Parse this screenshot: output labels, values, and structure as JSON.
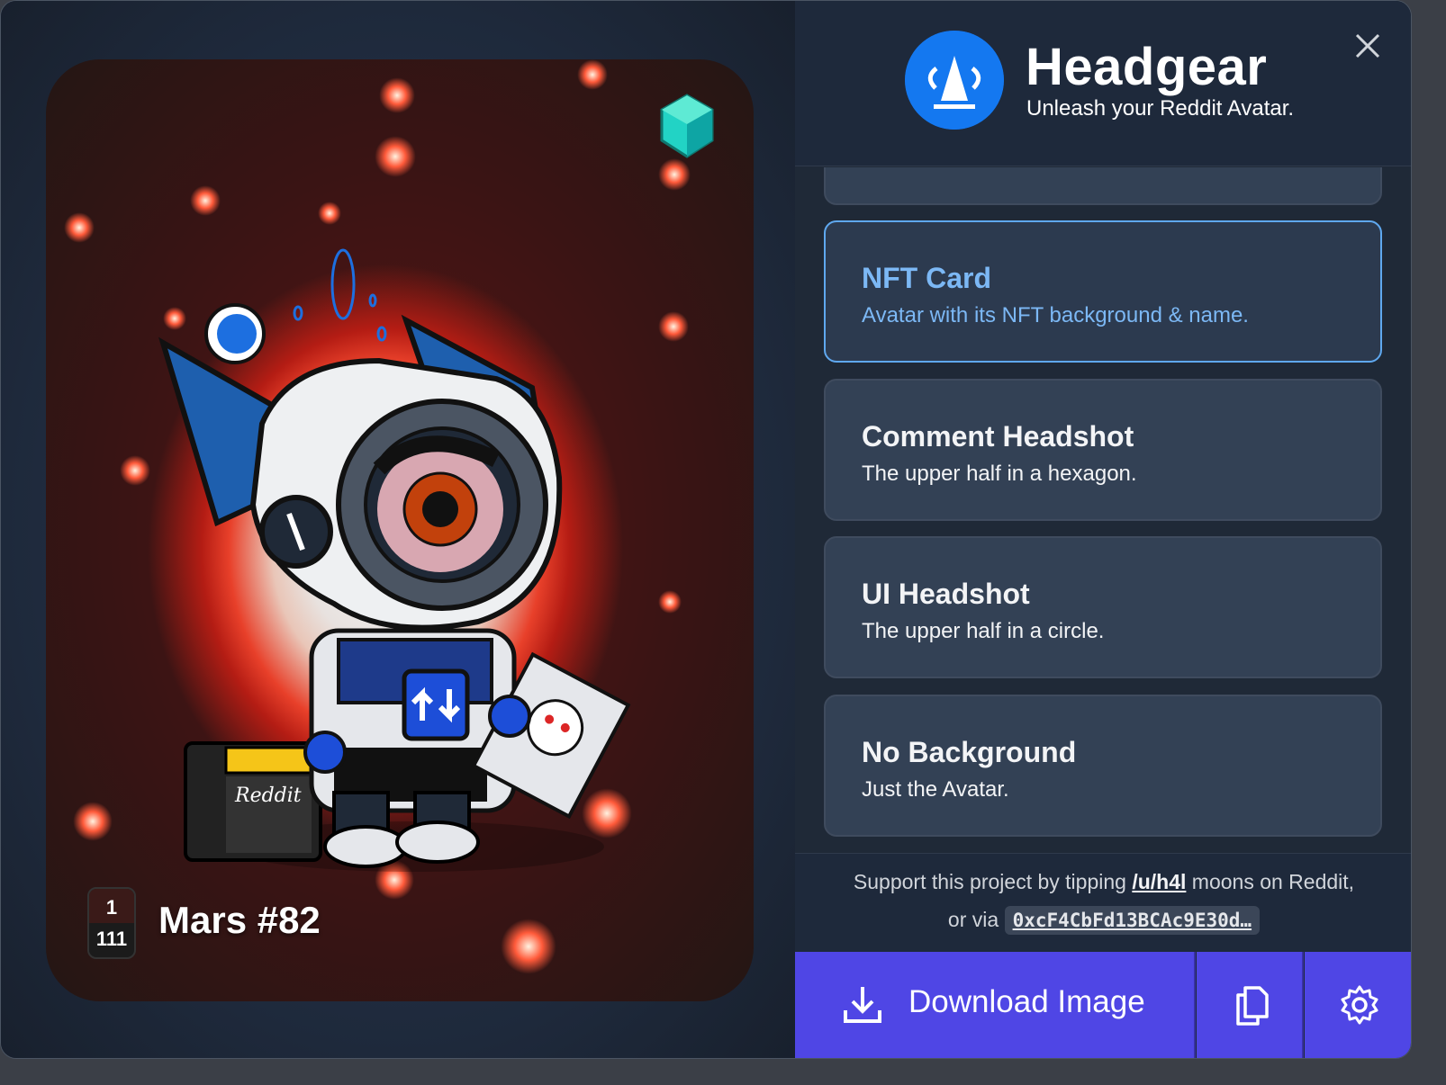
{
  "header": {
    "title": "Headgear",
    "subtitle": "Unleash your Reddit Avatar.",
    "close_icon": "close-icon"
  },
  "nft": {
    "name": "Mars #82",
    "edition_number": "1",
    "edition_total": "111",
    "card_text": "Reddit"
  },
  "options": [
    {
      "title": "",
      "description": ""
    },
    {
      "title": "NFT Card",
      "description": "Avatar with its NFT background & name.",
      "selected": true
    },
    {
      "title": "Comment Headshot",
      "description": "The upper half in a hexagon."
    },
    {
      "title": "UI Headshot",
      "description": "The upper half in a circle."
    },
    {
      "title": "No Background",
      "description": "Just the Avatar."
    }
  ],
  "support": {
    "line1_prefix": "Support this project by tipping",
    "user_link": "/u/h4l",
    "line1_suffix": "moons on Reddit,",
    "line2_prefix": "or via",
    "address": "0xcF4CbFd13BCAc9E30d…"
  },
  "actions": {
    "download_label": "Download Image",
    "download_icon": "download-icon",
    "copy_icon": "copy-icon",
    "settings_icon": "gear-icon"
  },
  "colors": {
    "accent": "#4f46e5",
    "selected_border": "#5fa8ef",
    "logo_blue": "#1478f0",
    "panel": "#1f2937"
  }
}
